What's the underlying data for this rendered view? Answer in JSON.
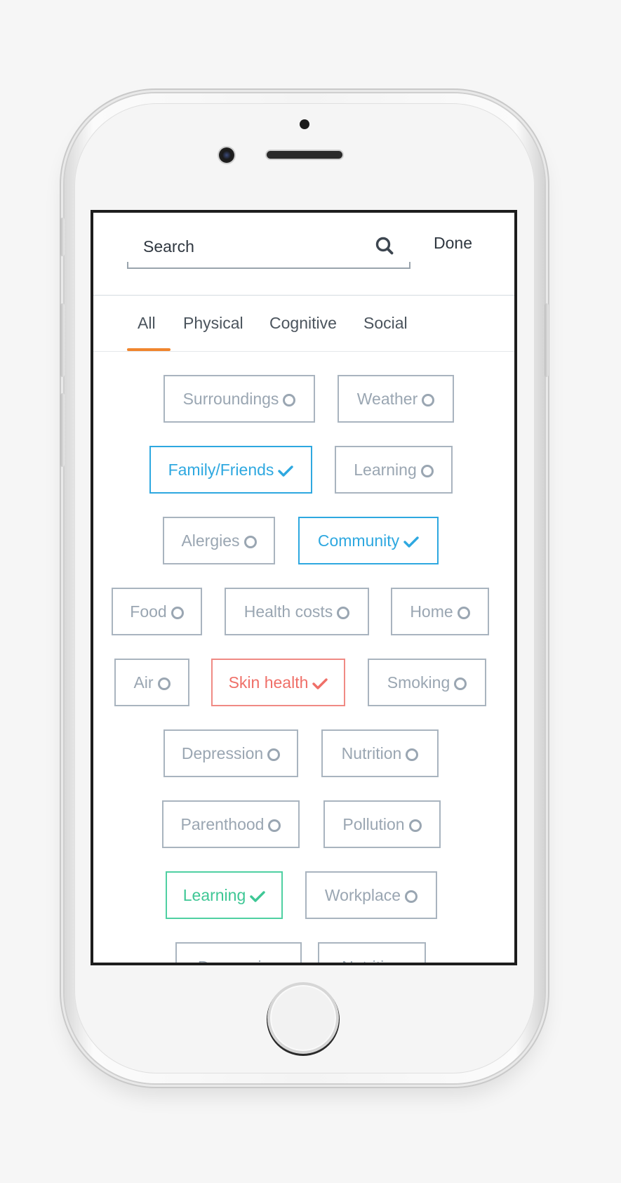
{
  "search": {
    "placeholder": "Search",
    "icon": "search-icon"
  },
  "header": {
    "done_label": "Done"
  },
  "tabs": [
    {
      "label": "All",
      "active": true
    },
    {
      "label": "Physical",
      "active": false
    },
    {
      "label": "Cognitive",
      "active": false
    },
    {
      "label": "Social",
      "active": false
    }
  ],
  "colors": {
    "accent_tab": "#f0852d",
    "selected_blue": "#2ea8e0",
    "selected_red": "#ef6f68",
    "selected_green": "#3ec795",
    "unselected": "#9aa6b2"
  },
  "chips": [
    {
      "label": "Surroundings",
      "state": "unselected"
    },
    {
      "label": "Weather",
      "state": "unselected"
    },
    {
      "label": "Family/Friends",
      "state": "selected"
    },
    {
      "label": "Learning",
      "state": "unselected"
    },
    {
      "label": "Alergies",
      "state": "unselected"
    },
    {
      "label": "Community",
      "state": "selected"
    },
    {
      "label": "Food",
      "state": "unselected"
    },
    {
      "label": "Health costs",
      "state": "unselected"
    },
    {
      "label": "Home",
      "state": "unselected"
    },
    {
      "label": "Air",
      "state": "unselected"
    },
    {
      "label": "Skin health",
      "state": "selected"
    },
    {
      "label": "Smoking",
      "state": "unselected"
    },
    {
      "label": "Depression",
      "state": "unselected"
    },
    {
      "label": "Nutrition",
      "state": "unselected"
    },
    {
      "label": "Parenthood",
      "state": "unselected"
    },
    {
      "label": "Pollution",
      "state": "unselected"
    },
    {
      "label": "Learning",
      "state": "selected"
    },
    {
      "label": "Workplace",
      "state": "unselected"
    },
    {
      "label": "Depression",
      "state": "unselected"
    },
    {
      "label": "Nutrition",
      "state": "unselected"
    }
  ]
}
